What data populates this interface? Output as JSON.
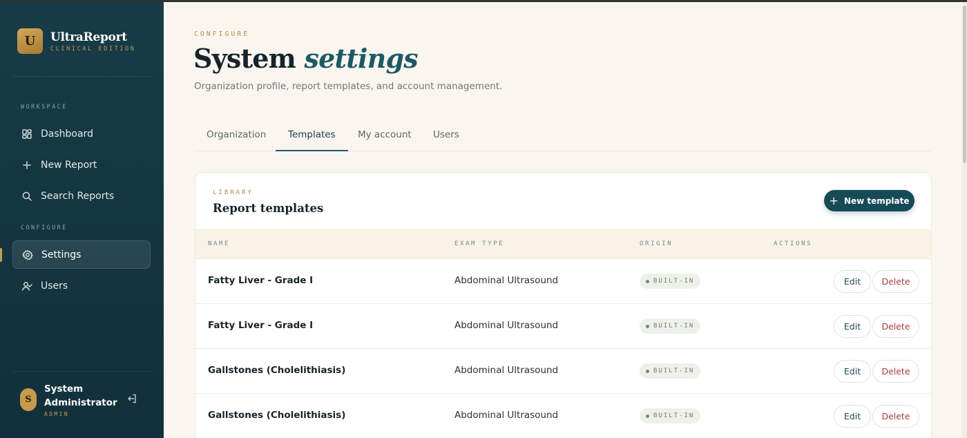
{
  "brand": {
    "logo_letter": "U",
    "name": "UltraReport",
    "subtitle": "CLINICAL EDITION"
  },
  "sidebar": {
    "sections": [
      {
        "label": "WORKSPACE"
      },
      {
        "label": "CONFIGURE"
      }
    ],
    "items": [
      {
        "label": "Dashboard",
        "icon": "dashboard-icon"
      },
      {
        "label": "New Report",
        "icon": "plus-icon"
      },
      {
        "label": "Search Reports",
        "icon": "search-icon"
      },
      {
        "label": "Settings",
        "icon": "gear-icon",
        "active": true
      },
      {
        "label": "Users",
        "icon": "users-icon"
      }
    ],
    "user": {
      "initial": "S",
      "name": "System Administrator",
      "role": "ADMIN"
    }
  },
  "header": {
    "eyebrow": "CONFIGURE",
    "title_plain": "System",
    "title_italic": "settings",
    "subtitle": "Organization profile, report templates, and account management."
  },
  "tabs": [
    {
      "label": "Organization"
    },
    {
      "label": "Templates",
      "active": true
    },
    {
      "label": "My account"
    },
    {
      "label": "Users"
    }
  ],
  "library": {
    "eyebrow": "LIBRARY",
    "title": "Report templates",
    "new_button_label": "New template",
    "columns": [
      "NAME",
      "EXAM TYPE",
      "ORIGIN",
      "ACTIONS"
    ],
    "rows": [
      {
        "name": "Fatty Liver - Grade I",
        "exam_type": "Abdominal Ultrasound",
        "origin": "BUILT-IN"
      },
      {
        "name": "Fatty Liver - Grade I",
        "exam_type": "Abdominal Ultrasound",
        "origin": "BUILT-IN"
      },
      {
        "name": "Gallstones (Cholelithiasis)",
        "exam_type": "Abdominal Ultrasound",
        "origin": "BUILT-IN"
      },
      {
        "name": "Gallstones (Cholelithiasis)",
        "exam_type": "Abdominal Ultrasound",
        "origin": "BUILT-IN"
      }
    ],
    "edit_label": "Edit",
    "delete_label": "Delete"
  },
  "colors": {
    "sidebar": "#173c48",
    "accent": "#164a56",
    "gold": "#c59b50",
    "danger": "#a4403c"
  }
}
